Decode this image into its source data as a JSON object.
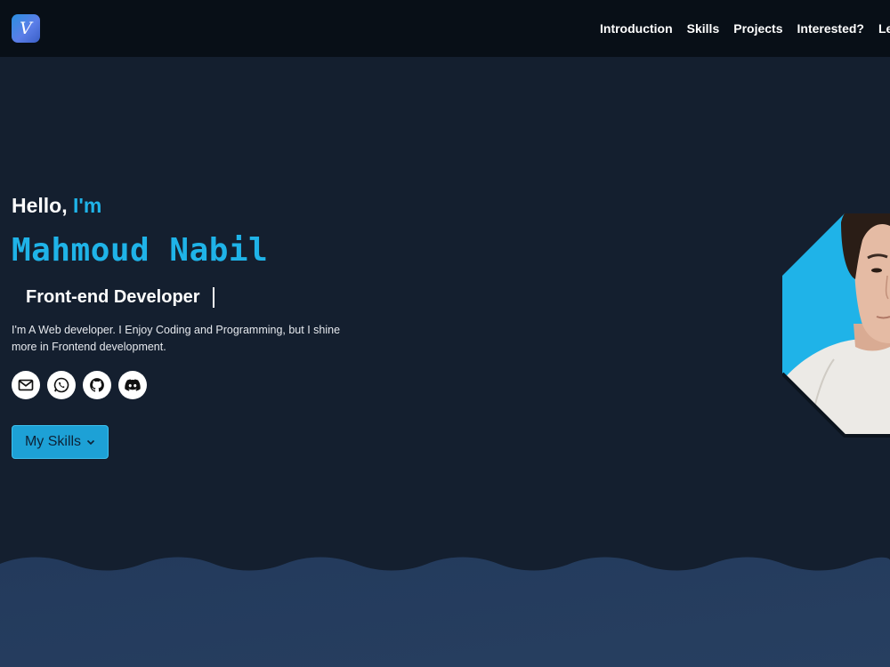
{
  "nav": {
    "logo_letter": "V",
    "links": [
      "Introduction",
      "Skills",
      "Projects",
      "Interested?",
      "Learn"
    ]
  },
  "hero": {
    "greeting_prefix": "Hello,",
    "greeting_accent": "I'm",
    "name": "Mahmoud Nabil",
    "role": "Front-end Developer",
    "bio": "I'm A Web developer. I Enjoy Coding and Programming, but I shine more in Frontend development.",
    "skills_button": "My Skills"
  },
  "icons": {
    "email": "email-icon",
    "whatsapp": "whatsapp-icon",
    "github": "github-icon",
    "discord": "discord-icon",
    "chevron": "chevron-down-icon"
  },
  "colors": {
    "accent": "#1fb3e8",
    "navbar_bg": "#080f17",
    "hero_bg": "#141f2f",
    "lower_bg": "#24395a",
    "button_bg": "#1da1d6"
  }
}
